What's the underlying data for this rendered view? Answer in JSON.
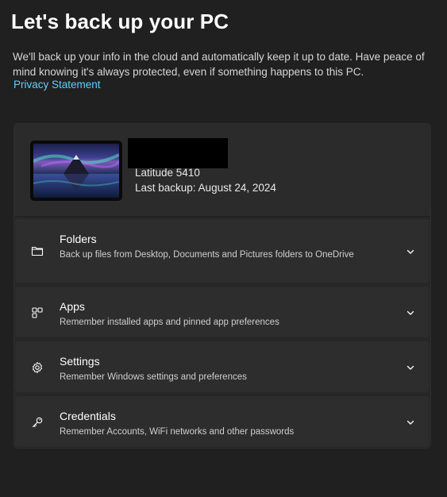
{
  "header": {
    "title": "Let's back up your PC",
    "description": "We'll back up your info in the cloud and automatically keep it up to date. Have peace of mind knowing it's always protected, even if something happens to this PC.",
    "privacy_link": "Privacy Statement"
  },
  "device": {
    "model": "Latitude 5410",
    "last_backup": "Last backup: August 24, 2024"
  },
  "sections": [
    {
      "icon": "folder-icon",
      "title": "Folders",
      "description": "Back up files from Desktop, Documents and Pictures folders to OneDrive"
    },
    {
      "icon": "apps-icon",
      "title": "Apps",
      "description": "Remember installed apps and pinned app preferences"
    },
    {
      "icon": "gear-icon",
      "title": "Settings",
      "description": "Remember Windows settings and preferences"
    },
    {
      "icon": "key-icon",
      "title": "Credentials",
      "description": "Remember Accounts, WiFi networks and other passwords"
    }
  ],
  "colors": {
    "background": "#202020",
    "card": "#2d2d2d",
    "link": "#60cdff"
  }
}
